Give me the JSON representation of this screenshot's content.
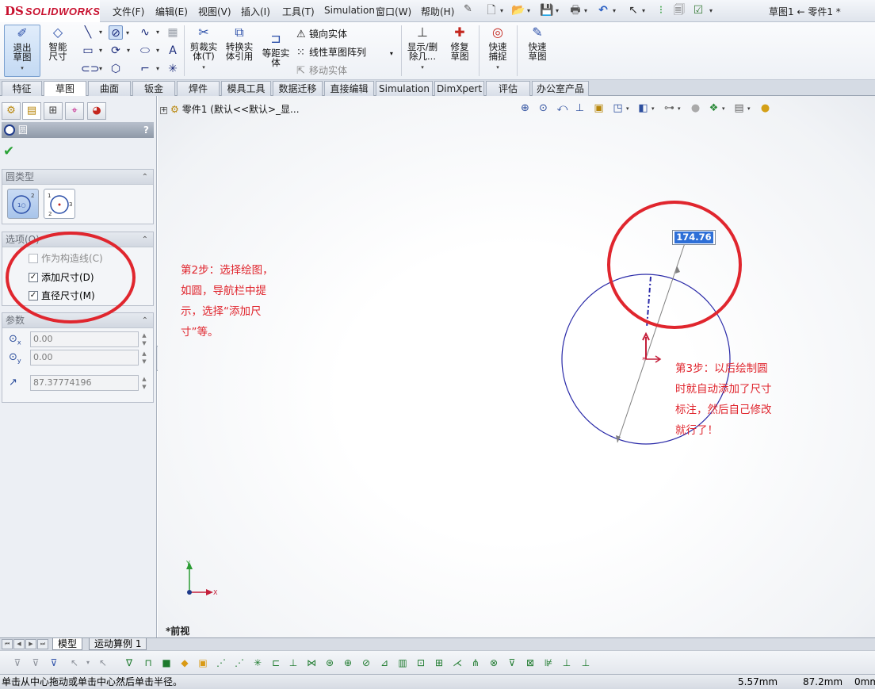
{
  "app": {
    "logo_mark": "DS",
    "logo_text": "SOLIDWORKS",
    "window_title": "草图1 ← 零件1 *"
  },
  "menus": [
    "文件(F)",
    "编辑(E)",
    "视图(V)",
    "插入(I)",
    "工具(T)",
    "Simulation",
    "窗口(W)",
    "帮助(H)"
  ],
  "ribbon": {
    "exit_sketch": "退出草图",
    "smart_dimension": "智能尺寸",
    "trim_entities": "剪裁实体(T)",
    "convert_entities": "转换实体引用",
    "offset_entities": "等距实体",
    "mirror_entities": "镜向实体",
    "linear_pattern": "线性草图阵列",
    "move_entities": "移动实体",
    "display_delete_relations": "显示/删除几...",
    "repair_sketch": "修复草图",
    "quick_snaps": "快速捕捉",
    "rapid_sketch": "快速草图"
  },
  "command_tabs": [
    "特征",
    "草图",
    "曲面",
    "钣金",
    "焊件",
    "模具工具",
    "数据迁移",
    "直接编辑",
    "Simulation",
    "DimXpert",
    "评估",
    "办公室产品"
  ],
  "property_manager": {
    "title": "圆",
    "help": "?",
    "circle_type_group": "圆类型",
    "options_group": "选项(O)",
    "option_construction": "作为构造线(C)",
    "option_add_dimensions": "添加尺寸(D)",
    "option_diameter_dimension": "直径尺寸(M)",
    "option_construction_checked": false,
    "option_add_dimensions_checked": true,
    "option_diameter_dimension_checked": true,
    "parameters_group": "参数",
    "param_center_x": "0.00",
    "param_center_y": "0.00",
    "param_radius": "87.37774196"
  },
  "graphics": {
    "tree_root": "零件1  (默认<<默认>_显...",
    "dimension_value": "174.76",
    "view_label": "*前视",
    "axis_x": "X",
    "axis_y": "Y",
    "note_step2": [
      "第2步：选择绘图，",
      "如圆，导航栏中提",
      "示，选择“添加尺",
      "寸”等。"
    ],
    "note_step3": [
      "第3步：以后绘制圆",
      "时就自动添加了尺寸",
      "标注，然后自己修改",
      "就行了！"
    ],
    "annotation_color": "#e0262e",
    "sketch_color": "#2a2aa8"
  },
  "model_tabs": [
    "模型",
    "运动算例 1"
  ],
  "status_bar": {
    "hint": "单击从中心拖动或单击中心然后单击半径。",
    "x": "5.57mm",
    "y": "87.2mm",
    "z": "0mm"
  }
}
